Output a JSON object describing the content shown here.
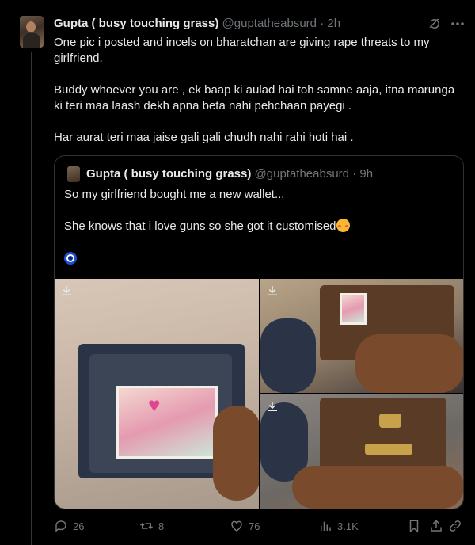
{
  "tweet": {
    "author_name": "Gupta ( busy touching grass)",
    "author_handle": "@guptatheabsurd",
    "separator": "·",
    "time": "2h",
    "paragraphs": [
      "One pic i posted and incels on bharatchan are giving rape threats to my girlfriend.",
      "Buddy whoever you are , ek baap ki aulad hai toh samne aaja, itna marunga ki teri maa laash dekh apna beta nahi pehchaan payegi .",
      "Har aurat teri maa jaise gali gali chudh nahi rahi hoti hai ."
    ]
  },
  "quote": {
    "author_name": "Gupta ( busy touching grass)",
    "author_handle": "@guptatheabsurd",
    "separator": "·",
    "time": "9h",
    "line1": "So my girlfriend bought me a new wallet...",
    "line2": "She knows that i love guns so she got it customised",
    "emoji_inline": "blush-hearts",
    "emoji_line": "nazar-amulet"
  },
  "actions": {
    "replies": "26",
    "reposts": "8",
    "likes": "76",
    "views": "3.1K"
  },
  "icons": {
    "grok": "grok-icon",
    "more": "more-icon",
    "download": "download-icon",
    "reply": "reply-icon",
    "repost": "repost-icon",
    "like": "heart-icon",
    "views": "views-icon",
    "bookmark": "bookmark-icon",
    "share": "share-icon"
  },
  "colors": {
    "background": "#000000",
    "text": "#e7e9ea",
    "muted": "#71767b",
    "border": "#2f3336"
  }
}
